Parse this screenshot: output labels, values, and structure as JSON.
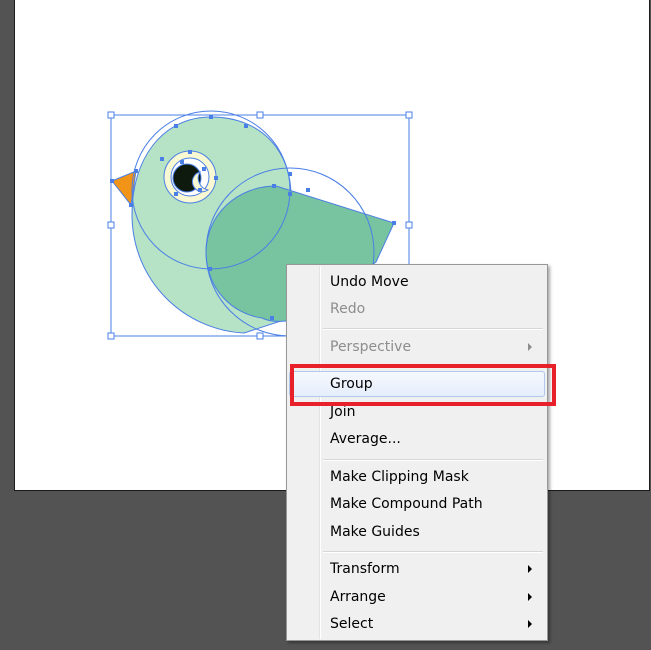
{
  "colors": {
    "workspace": "#535353",
    "artboard": "#ffffff",
    "selection": "#4a7fe5",
    "bird_body": "#b6e3c6",
    "bird_wing": "#78c4a0",
    "bird_beak": "#f29418",
    "bird_eye_outer": "#f8f8d2",
    "bird_eye_pupil": "#0d1a0d",
    "callout": "#e8202a"
  },
  "context_menu": {
    "items": [
      {
        "label": "Undo Move",
        "enabled": true
      },
      {
        "label": "Redo",
        "enabled": false
      },
      {
        "label": "Perspective",
        "enabled": false,
        "submenu": true
      },
      {
        "label": "Group",
        "enabled": true,
        "highlighted": true
      },
      {
        "label": "Join",
        "enabled": true
      },
      {
        "label": "Average...",
        "enabled": true
      },
      {
        "label": "Make Clipping Mask",
        "enabled": true
      },
      {
        "label": "Make Compound Path",
        "enabled": true
      },
      {
        "label": "Make Guides",
        "enabled": true
      },
      {
        "label": "Transform",
        "enabled": true,
        "submenu": true
      },
      {
        "label": "Arrange",
        "enabled": true,
        "submenu": true
      },
      {
        "label": "Select",
        "enabled": true,
        "submenu": true
      }
    ]
  }
}
